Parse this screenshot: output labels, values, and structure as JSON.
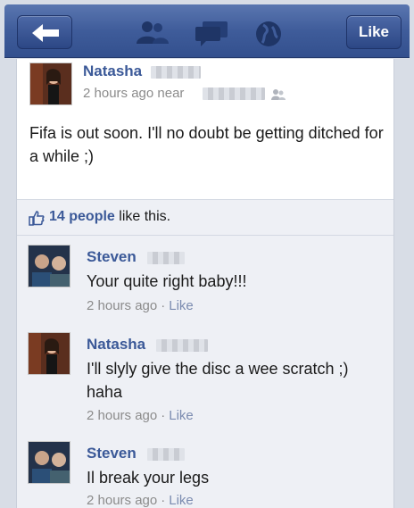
{
  "navbar": {
    "like_label": "Like",
    "icons": [
      "back-arrow-icon",
      "friends-icon",
      "messages-icon",
      "globe-icon"
    ]
  },
  "post": {
    "author": "Natasha",
    "time": "2 hours ago near",
    "text": "Fifa is out soon. I'll no doubt be getting ditched for a while ;)"
  },
  "likes": {
    "count": "14 people",
    "suffix": "like this."
  },
  "comments": [
    {
      "author": "Steven",
      "text": "Your quite right baby!!!",
      "time": "2 hours ago",
      "like": "Like"
    },
    {
      "author": "Natasha",
      "text": "I'll slyly give the disc a wee scratch ;) haha",
      "time": "2 hours ago",
      "like": "Like"
    },
    {
      "author": "Steven",
      "text": "Il break your legs",
      "time": "2 hours ago",
      "like": "Like"
    }
  ],
  "colors": {
    "brand": "#3b5998",
    "nav": "#3f5c9a",
    "meta": "#8b8b8b"
  }
}
